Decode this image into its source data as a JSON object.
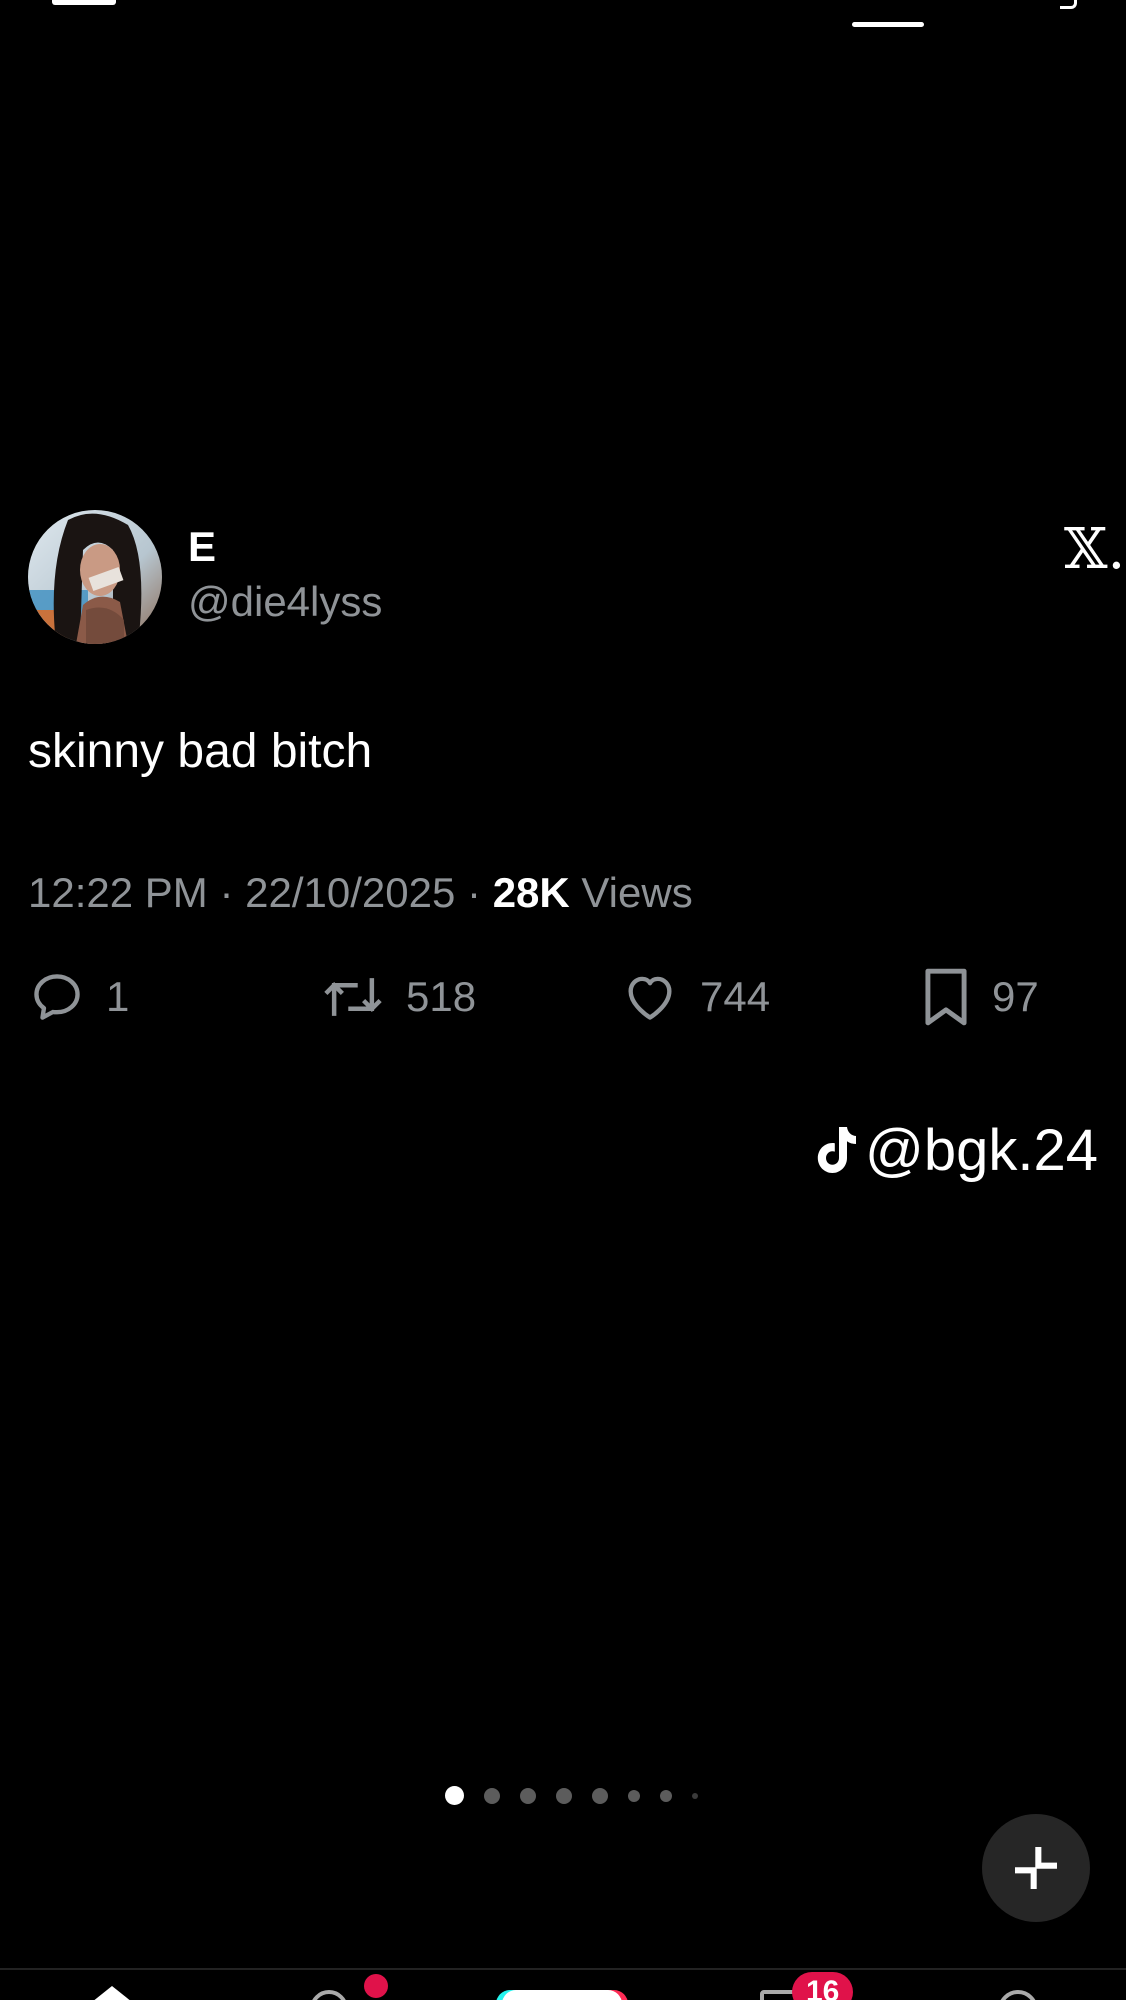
{
  "tweet": {
    "display_name": "E",
    "handle": "@die4lyss",
    "text": "skinny bad bitch",
    "time": "12:22 PM",
    "separator": "·",
    "date": "22/10/2025",
    "views_count": "28K",
    "views_label": "Views",
    "replies": "1",
    "retweets": "518",
    "likes": "744",
    "bookmarks": "97",
    "platform_logo": "𝕏."
  },
  "watermark": {
    "icon": "tiktok-icon",
    "text": "@bgk.24"
  },
  "carousel": {
    "total_dots": 8,
    "active_index": 0
  },
  "bottom_nav": {
    "inbox_badge": "16"
  },
  "colors": {
    "background": "#000000",
    "primary_text": "#ffffff",
    "secondary_text": "#8f9397",
    "badge": "#e0124a"
  }
}
